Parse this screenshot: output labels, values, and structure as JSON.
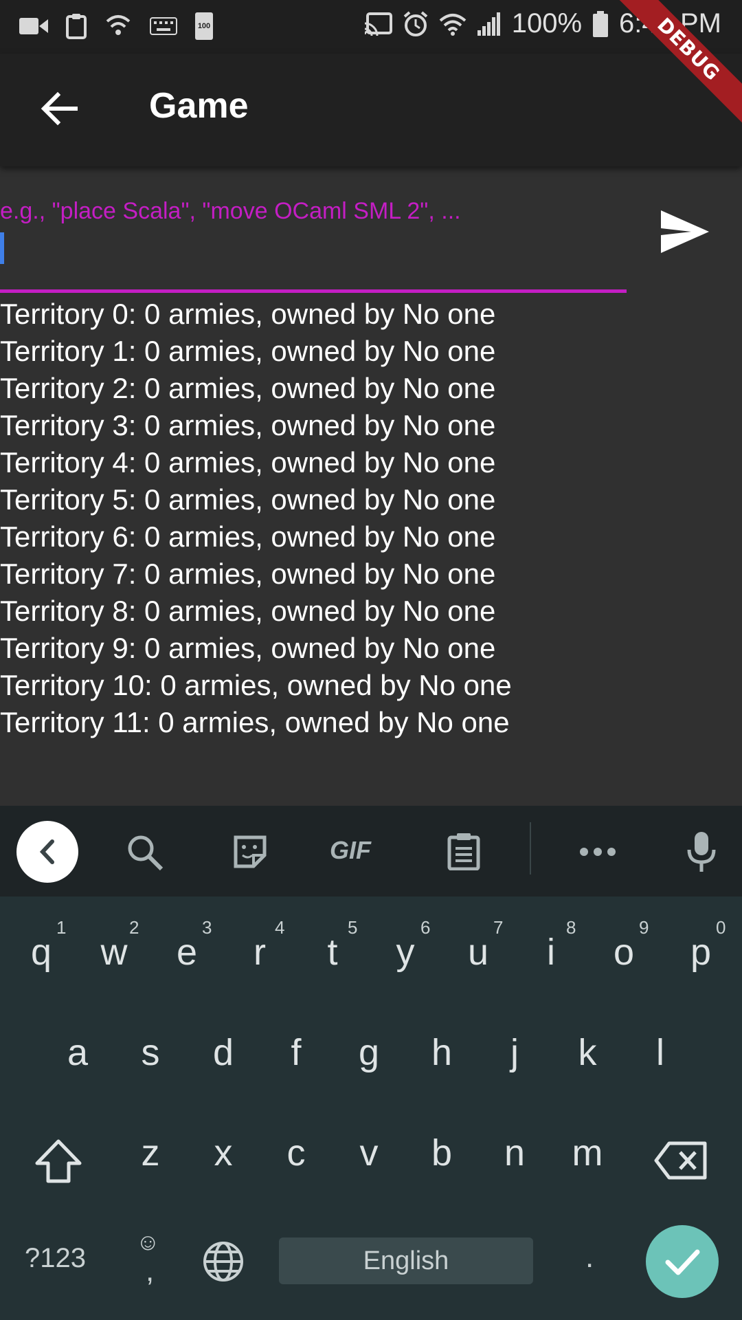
{
  "status_bar": {
    "battery_percent": "100%",
    "time": "6:41 PM",
    "battery_icon_label": "100"
  },
  "debug_banner": "DEBUG",
  "app_bar": {
    "title": "Game"
  },
  "command_input": {
    "placeholder": "e.g., \"place Scala\", \"move OCaml SML 2\", ...",
    "value": ""
  },
  "territories": [
    "Territory 0: 0 armies, owned by No one",
    "Territory 1: 0 armies, owned by No one",
    "Territory 2: 0 armies, owned by No one",
    "Territory 3: 0 armies, owned by No one",
    "Territory 4: 0 armies, owned by No one",
    "Territory 5: 0 armies, owned by No one",
    "Territory 6: 0 armies, owned by No one",
    "Territory 7: 0 armies, owned by No one",
    "Territory 8: 0 armies, owned by No one",
    "Territory 9: 0 armies, owned by No one",
    "Territory 10: 0 armies, owned by No one",
    "Territory 11: 0 armies, owned by No one"
  ],
  "keyboard": {
    "toolbar": {
      "gif_label": "GIF"
    },
    "row1": [
      "q",
      "w",
      "e",
      "r",
      "t",
      "y",
      "u",
      "i",
      "o",
      "p"
    ],
    "row1_hints": [
      "1",
      "2",
      "3",
      "4",
      "5",
      "6",
      "7",
      "8",
      "9",
      "0"
    ],
    "row2": [
      "a",
      "s",
      "d",
      "f",
      "g",
      "h",
      "j",
      "k",
      "l"
    ],
    "row3": [
      "z",
      "x",
      "c",
      "v",
      "b",
      "n",
      "m"
    ],
    "symbols_label": "?123",
    "emoji_glyph": "☺",
    "comma": ",",
    "space_label": "English",
    "period": "."
  }
}
